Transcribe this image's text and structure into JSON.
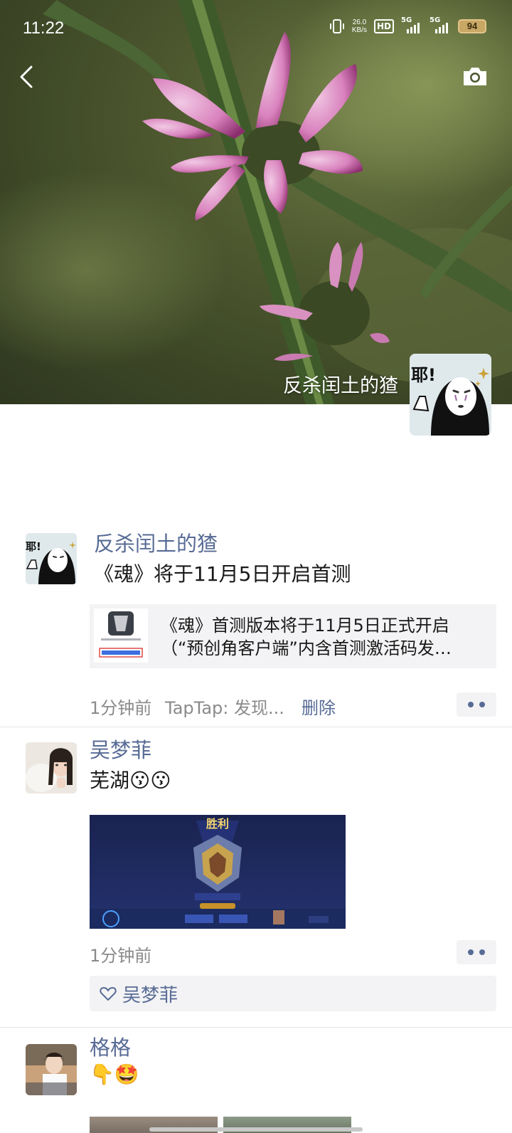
{
  "status_bar": {
    "time": "11:22",
    "net_speed_value": "26.0",
    "net_speed_unit": "KB/s",
    "hd_label": "HD",
    "sim1_label": "5G",
    "sim2_label": "5G",
    "battery": "94"
  },
  "cover": {
    "user_name": "反杀闰土的猹",
    "avatar_text": "耶!"
  },
  "posts": [
    {
      "name": "反杀闰土的猹",
      "avatar_text": "耶!",
      "text": "《魂》将于11月5日开启首测",
      "link_title": "《魂》首测版本将于11月5日正式开启",
      "link_subtitle": "（“预创角客户端”内含首测激活码发…",
      "time": "1分钟前",
      "source": "TapTap: 发现...",
      "delete_label": "删除"
    },
    {
      "name": "吴梦菲",
      "text": "芜湖😗😗",
      "game_title": "胜利",
      "time": "1分钟前",
      "like_names": "吴梦菲"
    },
    {
      "name": "格格",
      "text": "👇🤩"
    }
  ],
  "icons": {
    "back": "chevron-left-icon",
    "camera": "camera-icon",
    "more": "more-dots-icon",
    "like": "heart-outline-icon"
  },
  "colors": {
    "link_blue": "#576b95",
    "meta_gray": "#8a8a8a",
    "card_bg": "#f3f3f5"
  }
}
